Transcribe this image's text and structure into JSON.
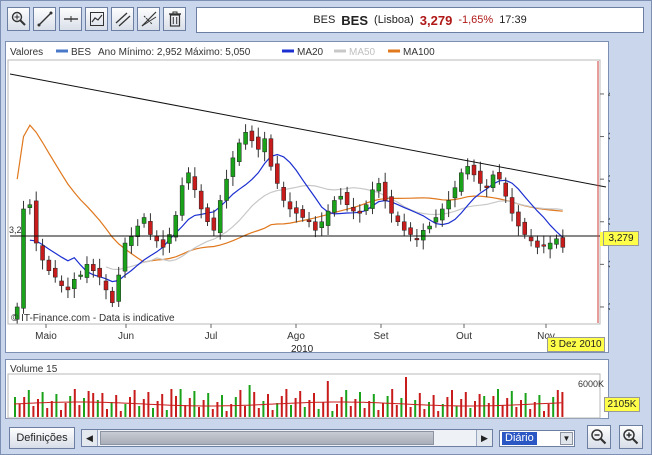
{
  "toolbar": {
    "buttons": [
      {
        "name": "zoom-crosshair-tool-button",
        "icon": "zoom-crosshair-icon"
      },
      {
        "name": "draw-line-tool-button",
        "icon": "diagonal-line-icon"
      },
      {
        "name": "horizontal-line-tool-button",
        "icon": "horizontal-line-icon"
      },
      {
        "name": "edit-study-tool-button",
        "icon": "edit-chart-icon"
      },
      {
        "name": "trend-channel-tool-button",
        "icon": "channel-icon"
      },
      {
        "name": "fibonacci-tool-button",
        "icon": "fan-line-icon"
      },
      {
        "name": "delete-button",
        "icon": "trash-icon"
      }
    ]
  },
  "quote": {
    "symbol_small": "BES",
    "symbol": "BES",
    "exchange": "(Lisboa)",
    "price": "3,279",
    "change": "-1,65%",
    "time": "17:39"
  },
  "legend": {
    "label": "Valores",
    "series_name": "BES",
    "range_text": "Ano Mínimo: 2,952 Máximo: 5,050",
    "ma20": "MA20",
    "ma50": "MA50",
    "ma100": "MA100"
  },
  "colors": {
    "up": "#1aa21a",
    "down": "#c81c1c",
    "ma20": "#1c2fd0",
    "ma50": "#c8c8c8",
    "ma100": "#e0781e",
    "trend": "#111111",
    "highlight": "#ffff4a"
  },
  "price_label": "3,279",
  "left_price_label": "3,2",
  "date_label": "3 Dez 2010",
  "watermark": "© IT-Finance.com - Data is indicative",
  "year_label": "2010",
  "volume": {
    "title": "Volume 15",
    "axis_top": "6000K",
    "current": "2105K"
  },
  "bottom": {
    "definitions_label": "Definições",
    "period_value": "Diário"
  },
  "chart_data": {
    "type": "candlestick",
    "x": [
      "Mai",
      "Jun",
      "Jul",
      "Ago",
      "Set",
      "Out",
      "Nov"
    ],
    "xtick_labels": [
      "Maio",
      "Jun",
      "Jul",
      "Ago",
      "Set",
      "Out",
      "Nov"
    ],
    "yticks": [
      "3",
      "3,2",
      "3,4",
      "3,6",
      "3,8",
      "4"
    ],
    "ylim": [
      2.92,
      4.15
    ],
    "close_series": [
      3.0,
      3.46,
      3.48,
      3.3,
      3.22,
      3.17,
      3.14,
      3.1,
      3.08,
      3.13,
      3.15,
      3.2,
      3.17,
      3.14,
      3.08,
      3.02,
      3.15,
      3.3,
      3.33,
      3.38,
      3.42,
      3.34,
      3.31,
      3.28,
      3.34,
      3.43,
      3.57,
      3.63,
      3.55,
      3.46,
      3.4,
      3.36,
      3.5,
      3.6,
      3.7,
      3.77,
      3.82,
      3.78,
      3.74,
      3.79,
      3.66,
      3.58,
      3.5,
      3.46,
      3.44,
      3.42,
      3.4,
      3.36,
      3.4,
      3.45,
      3.5,
      3.52,
      3.48,
      3.45,
      3.44,
      3.48,
      3.55,
      3.58,
      3.5,
      3.44,
      3.4,
      3.36,
      3.34,
      3.32,
      3.36,
      3.38,
      3.42,
      3.46,
      3.5,
      3.56,
      3.63,
      3.66,
      3.62,
      3.58,
      3.56,
      3.62,
      3.6,
      3.52,
      3.44,
      3.38,
      3.34,
      3.31,
      3.28,
      3.29,
      3.3,
      3.32,
      3.28
    ],
    "volume_range": [
      0,
      6000
    ],
    "volume_current": 2105,
    "date_range_end": "3 Dez 2010"
  }
}
